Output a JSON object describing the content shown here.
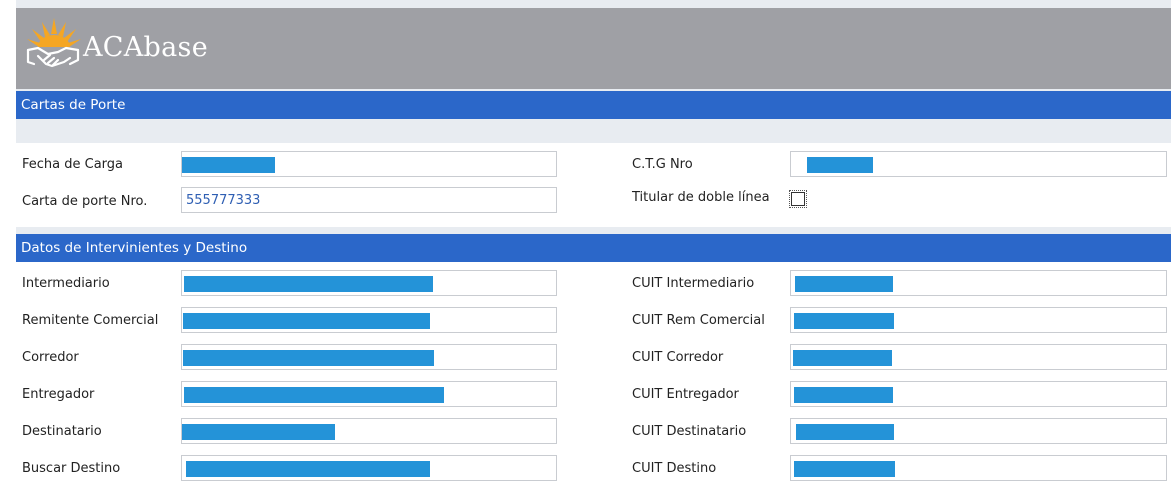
{
  "brand": {
    "name": "ACAbase",
    "logo_icon": "handshake-sun-logo-icon"
  },
  "colors": {
    "header": "#9fa0a5",
    "section_bar": "#2b67c9",
    "redaction": "#2493d8"
  },
  "sections": {
    "cartas_de_porte": "Cartas de Porte",
    "datos": "Datos de Intervinientes y Destino"
  },
  "cartas": {
    "fecha_de_carga": {
      "label": "Fecha de Carga",
      "value": ""
    },
    "carta_de_porte": {
      "label": "Carta de porte Nro.",
      "value": "555777333"
    },
    "ctg": {
      "label": "C.T.G Nro",
      "value": ""
    },
    "titular_doble_linea": {
      "label": "Titular de doble línea",
      "checked": false
    }
  },
  "intervinientes": {
    "intermediario": "Intermediario",
    "remitente": "Remitente Comercial",
    "corredor": "Corredor",
    "entregador": "Entregador",
    "destinatario": "Destinatario",
    "buscar_destino": "Buscar Destino",
    "cuit_intermediario": "CUIT Intermediario",
    "cuit_remitente": "CUIT Rem Comercial",
    "cuit_corredor": "CUIT Corredor",
    "cuit_entregador": "CUIT Entregador",
    "cuit_destinatario": "CUIT Destinatario",
    "cuit_destino": "CUIT Destino"
  }
}
